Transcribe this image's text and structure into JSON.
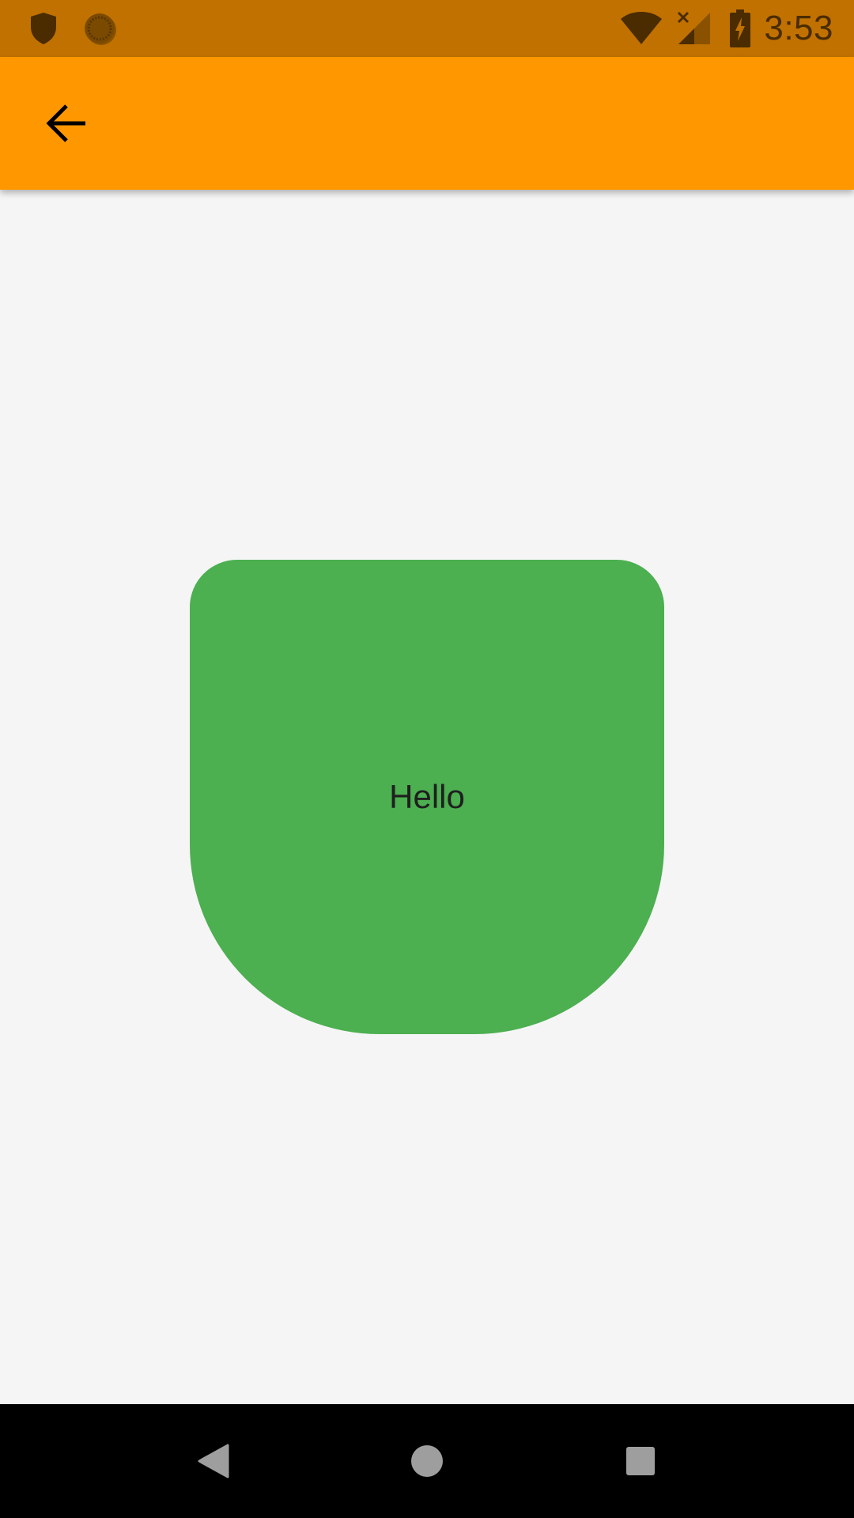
{
  "status_bar": {
    "time": "3:53",
    "left_icons": [
      "shield-icon",
      "sync-icon"
    ],
    "right_icons": [
      "wifi-icon",
      "signal-no-service-icon",
      "battery-charging-icon"
    ],
    "background": "#c17100",
    "icon_color": "#4a2c00"
  },
  "app_bar": {
    "background": "#ff9800",
    "back_icon": "arrow-back-icon"
  },
  "main": {
    "shape_label": "Hello",
    "shape_color": "#4caf50",
    "background": "#f5f5f5"
  },
  "nav_bar": {
    "buttons": [
      "back-triangle-icon",
      "home-circle-icon",
      "recents-square-icon"
    ],
    "icon_color": "#9e9e9e"
  }
}
